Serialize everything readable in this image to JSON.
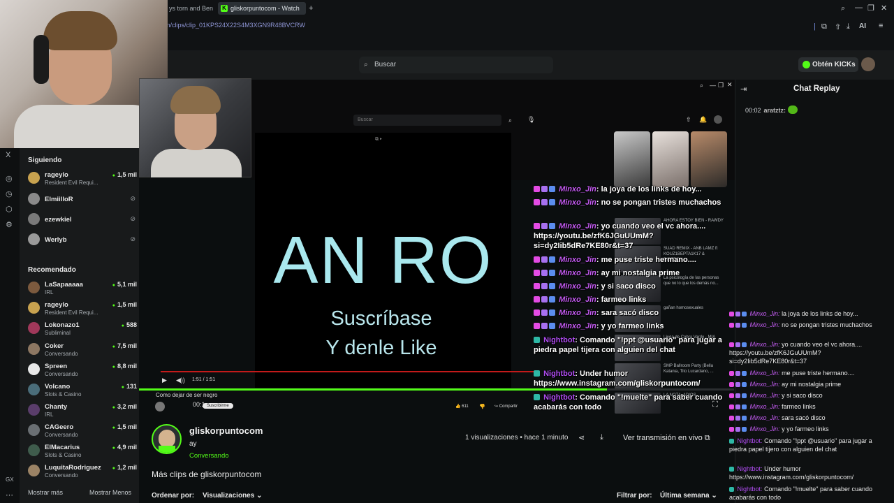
{
  "browser": {
    "tabs": [
      {
        "label": "ys torn and Ben r"
      },
      {
        "label": "gliskorpuntocom - Watch"
      }
    ],
    "new_tab": "+",
    "url": "m/clips/clip_01KPS24X22S4M3XGN9R48BVCRW",
    "ai_label": "AI"
  },
  "header": {
    "search_placeholder": "Buscar",
    "kicks_button": "Obtén KICKs"
  },
  "sidebar": {
    "following_title": "Siguiendo",
    "following": [
      {
        "name": "rageylo",
        "sub": "Resident Evil Requi...",
        "viewers": "1,5 mil"
      },
      {
        "name": "ElmiilloR",
        "sub": "",
        "viewers": ""
      },
      {
        "name": "ezewkiel",
        "sub": "",
        "viewers": ""
      },
      {
        "name": "Werlyb",
        "sub": "",
        "viewers": ""
      }
    ],
    "recommended_title": "Recomendado",
    "recommended": [
      {
        "name": "LaSapaaaaa",
        "sub": "IRL",
        "viewers": "5,1 mil"
      },
      {
        "name": "rageylo",
        "sub": "Resident Evil Requi...",
        "viewers": "1,5 mil"
      },
      {
        "name": "Lokonazo1",
        "sub": "Subliminal",
        "viewers": "588"
      },
      {
        "name": "Coker",
        "sub": "Conversando",
        "viewers": "7,5 mil"
      },
      {
        "name": "Spreen",
        "sub": "Conversando",
        "viewers": "8,8 mil"
      },
      {
        "name": "Volcano",
        "sub": "Slots & Casino",
        "viewers": "131"
      },
      {
        "name": "Chanty",
        "sub": "IRL",
        "viewers": "3,2 mil"
      },
      {
        "name": "CAGeero",
        "sub": "Conversando",
        "viewers": "1,5 mil"
      },
      {
        "name": "ElMacarius",
        "sub": "Slots & Casino",
        "viewers": "4,9 mil"
      },
      {
        "name": "LuquitaRodriguez",
        "sub": "Conversando",
        "viewers": "1,2 mil"
      }
    ],
    "show_more": "Mostrar más",
    "show_less": "Mostrar Menos"
  },
  "video": {
    "inner_search": "Buscar",
    "big_text": "AN RO",
    "line1": "Suscríbase",
    "line2": "Y denle Like",
    "time": "1:51 / 1:51",
    "video_title": "Como dejar de ser negro",
    "subscribe": "Suscribirme",
    "likes": "611",
    "share": "Compartir",
    "timestamp_overlay": "00:1"
  },
  "thumbnails": [
    {
      "text": "AHORA ESTOY BIEN - RAWDY"
    },
    {
      "text": "SUAD REMIX - ANB LAMZ ft KOUZ1BEPTA1K17 & RIBERON..."
    },
    {
      "text": "La psicología de las personas que no lo que los demás no..."
    },
    {
      "text": "gañan homosexuales"
    },
    {
      "text": "Llega de Cobra Vardo - MIA"
    },
    {
      "text": "SMP Ballroom Party (Bella Katania, Tito Lucardano, ..."
    },
    {
      "text": "LA NOTA, ADIÓS"
    }
  ],
  "overlay_chat": [
    {
      "user": "Minxo_Jin",
      "text": "la joya de los links de hoy..."
    },
    {
      "user": "Minxo_Jin",
      "text": "no se pongan tristes muchachos"
    },
    {
      "user": "Minxo_Jin",
      "text": "yo cuando veo el vc ahora.... https://youtu.be/zfK6JGuUUmM?si=dy2Iib5dRe7KE80r&t=37"
    },
    {
      "user": "Minxo_Jin",
      "text": "me puse triste hermano...."
    },
    {
      "user": "Minxo_Jin",
      "text": "ay mi nostalgia prime"
    },
    {
      "user": "Minxo_Jin",
      "text": "y si saco disco"
    },
    {
      "user": "Minxo_Jin",
      "text": "farmeo links"
    },
    {
      "user": "Minxo_Jin",
      "text": "sara sacó disco"
    },
    {
      "user": "Minxo_Jin",
      "text": "y yo farmeo links"
    },
    {
      "user": "Nightbot",
      "text": "Comando \"!ppt @usuario\" para jugar a piedra papel tijera con alguien del chat"
    },
    {
      "user": "Nightbot",
      "text": "Under humor https://www.instagram.com/gliskorpuntocom/"
    },
    {
      "user": "Nightbot",
      "text": "Comando \"!muelte\" para saber cuando acabarás con todo"
    }
  ],
  "clip": {
    "channel": "gliskorpuntocom",
    "title": "ay",
    "category": "Conversando",
    "views": "1 visualizaciones",
    "age": "hace 1 minuto",
    "live_button": "Ver transmisión en vivo",
    "more_clips": "Más clips de gliskorpuntocom",
    "sort_label": "Ordenar por:",
    "sort_value": "Visualizaciones",
    "filter_label": "Filtrar por:",
    "filter_value": "Última semana"
  },
  "chat": {
    "title": "Chat Replay",
    "first": {
      "time": "00:02",
      "user": "aratztz:"
    },
    "messages": [
      {
        "user": "Minxo_Jin:",
        "text": "la joya de los links de hoy..."
      },
      {
        "user": "Minxo_Jin:",
        "text": "no se pongan tristes muchachos"
      },
      {
        "user": "Minxo_Jin:",
        "text": "yo cuando veo el vc ahora.... https://youtu.be/zfK6JGuUUmM?si=dy2Iib5dRe7KE80r&t=37"
      },
      {
        "user": "Minxo_Jin:",
        "text": "me puse triste hermano...."
      },
      {
        "user": "Minxo_Jin:",
        "text": "ay mi nostalgia prime"
      },
      {
        "user": "Minxo_Jin:",
        "text": "y si saco disco"
      },
      {
        "user": "Minxo_Jin:",
        "text": "farmeo links"
      },
      {
        "user": "Minxo_Jin:",
        "text": "sara sacó disco"
      },
      {
        "user": "Minxo_Jin:",
        "text": "y yo farmeo links"
      },
      {
        "user": "Nightbot:",
        "text": "Comando \"!ppt @usuario\" para jugar a piedra papel tijero con alguien del chat"
      },
      {
        "user": "Nightbot:",
        "text": "Under humor https://www.instagram.com/gliskorpuntocom/"
      },
      {
        "user": "Nightbot:",
        "text": "Comando \"!muelte\" para saber cuando acabarás con todo"
      }
    ]
  },
  "colors": {
    "kick_green": "#53fc18",
    "username_purple": "#c65cf5",
    "progress_red": "#c31a1a"
  }
}
